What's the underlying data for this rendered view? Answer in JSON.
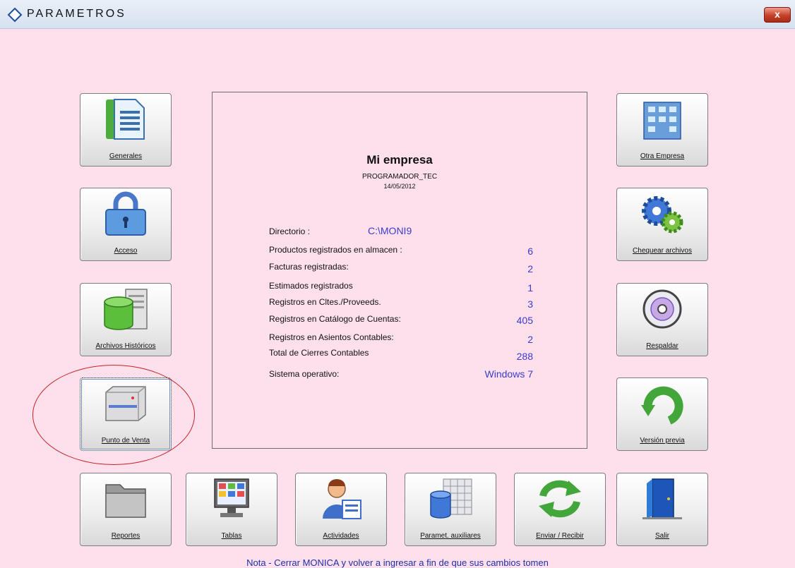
{
  "window": {
    "title": "PARAMETROS",
    "close_label": "x"
  },
  "buttons": {
    "generales": "Generales",
    "acceso": "Acceso",
    "archivos_historicos": "Archivos Históricos",
    "punto_de_venta": "Punto de Venta",
    "otra_empresa": "Otra Empresa",
    "chequear_archivos": "Chequear archivos",
    "respaldar": "Respaldar",
    "version_previa": "Versión previa",
    "reportes": "Reportes",
    "tablas": "Tablas",
    "actividades": "Actividades",
    "paramet_auxiliares": "Paramet. auxiliares",
    "enviar_recibir": "Enviar / Recibir",
    "salir": "Salir"
  },
  "info": {
    "company": "Mi empresa",
    "user": "PROGRAMADOR_TEC",
    "date": "14/05/2012",
    "directorio_label": "Directorio :",
    "directorio_value": "C:\\MONI9",
    "rows": [
      {
        "label": "Productos registrados en almacen :",
        "value": "6"
      },
      {
        "label": "Facturas registradas:",
        "value": "2"
      },
      {
        "label": "Estimados registrados",
        "value": "1"
      },
      {
        "label": "Registros en Cltes./Proveeds.",
        "value": "3"
      },
      {
        "label": "Registros en Catálogo de Cuentas:",
        "value": "405"
      },
      {
        "label": "Registros en Asientos Contables:",
        "value": "2"
      },
      {
        "label": "Total de Cierres Contables",
        "value": "288"
      },
      {
        "label": "Sistema operativo:",
        "value": "Windows 7"
      }
    ]
  },
  "note": "Nota - Cerrar MONICA y volver a ingresar a fin de que sus cambios tomen",
  "colors": {
    "background": "#fde0ec",
    "value_blue": "#3c3cc8",
    "highlight_red": "#c42626"
  }
}
